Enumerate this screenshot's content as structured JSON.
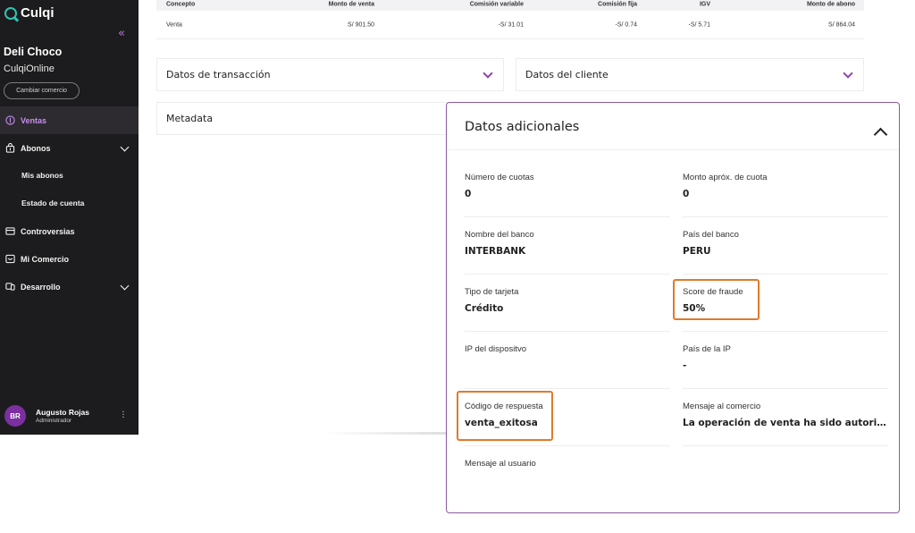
{
  "app": {
    "brand": "Culqi",
    "collapse_glyph": "«"
  },
  "merchant": {
    "name": "Deli Choco",
    "subtitle": "CulqiOnline",
    "switch_label": "Cambiar comercio"
  },
  "nav": {
    "ventas": "Ventas",
    "abonos": "Abonos",
    "mis_abonos": "Mis abonos",
    "estado_cuenta": "Estado de cuenta",
    "controversias": "Controversias",
    "mi_comercio": "Mi Comercio",
    "desarrollo": "Desarrollo"
  },
  "user": {
    "initials": "BR",
    "name": "Augusto Rojas",
    "role": "Administrador"
  },
  "table": {
    "headers": [
      "Concepto",
      "Monto de venta",
      "Comisión variable",
      "Comisión fija",
      "IGV",
      "Monto de abono"
    ],
    "row": [
      "Venta",
      "S/ 901.50",
      "-S/ 31.01",
      "-S/ 0.74",
      "-S/ 5.71",
      "S/ 864.04"
    ]
  },
  "sections": {
    "transaccion": "Datos de transacción",
    "cliente": "Datos del cliente",
    "metadata": "Metadata"
  },
  "panel": {
    "title": "Datos adicionales",
    "fields": {
      "cuotas_label": "Número de cuotas",
      "cuotas_value": "0",
      "monto_cuota_label": "Monto apróx. de cuota",
      "monto_cuota_value": "0",
      "banco_label": "Nombre del banco",
      "banco_value": "INTERBANK",
      "pais_banco_label": "País del banco",
      "pais_banco_value": "PERU",
      "tipo_tarjeta_label": "Tipo de tarjeta",
      "tipo_tarjeta_value": "Crédito",
      "score_label": "Score de fraude",
      "score_value": "50%",
      "ip_label": "IP del dispositvo",
      "ip_value": "",
      "pais_ip_label": "País de la IP",
      "pais_ip_value": "-",
      "codigo_label": "Código de respuesta",
      "codigo_value": "venta_exitosa",
      "mensaje_comercio_label": "Mensaje al comercio",
      "mensaje_comercio_value": "La operación de venta ha sido autorizada exitosamente",
      "mensaje_usuario_label": "Mensaje al usuario",
      "mensaje_usuario_value": ""
    }
  },
  "colors": {
    "sidebar_bg": "#1c1c1e",
    "accent": "#8e44ad",
    "highlight": "#e07a2c",
    "brand": "#2ec4b6"
  }
}
